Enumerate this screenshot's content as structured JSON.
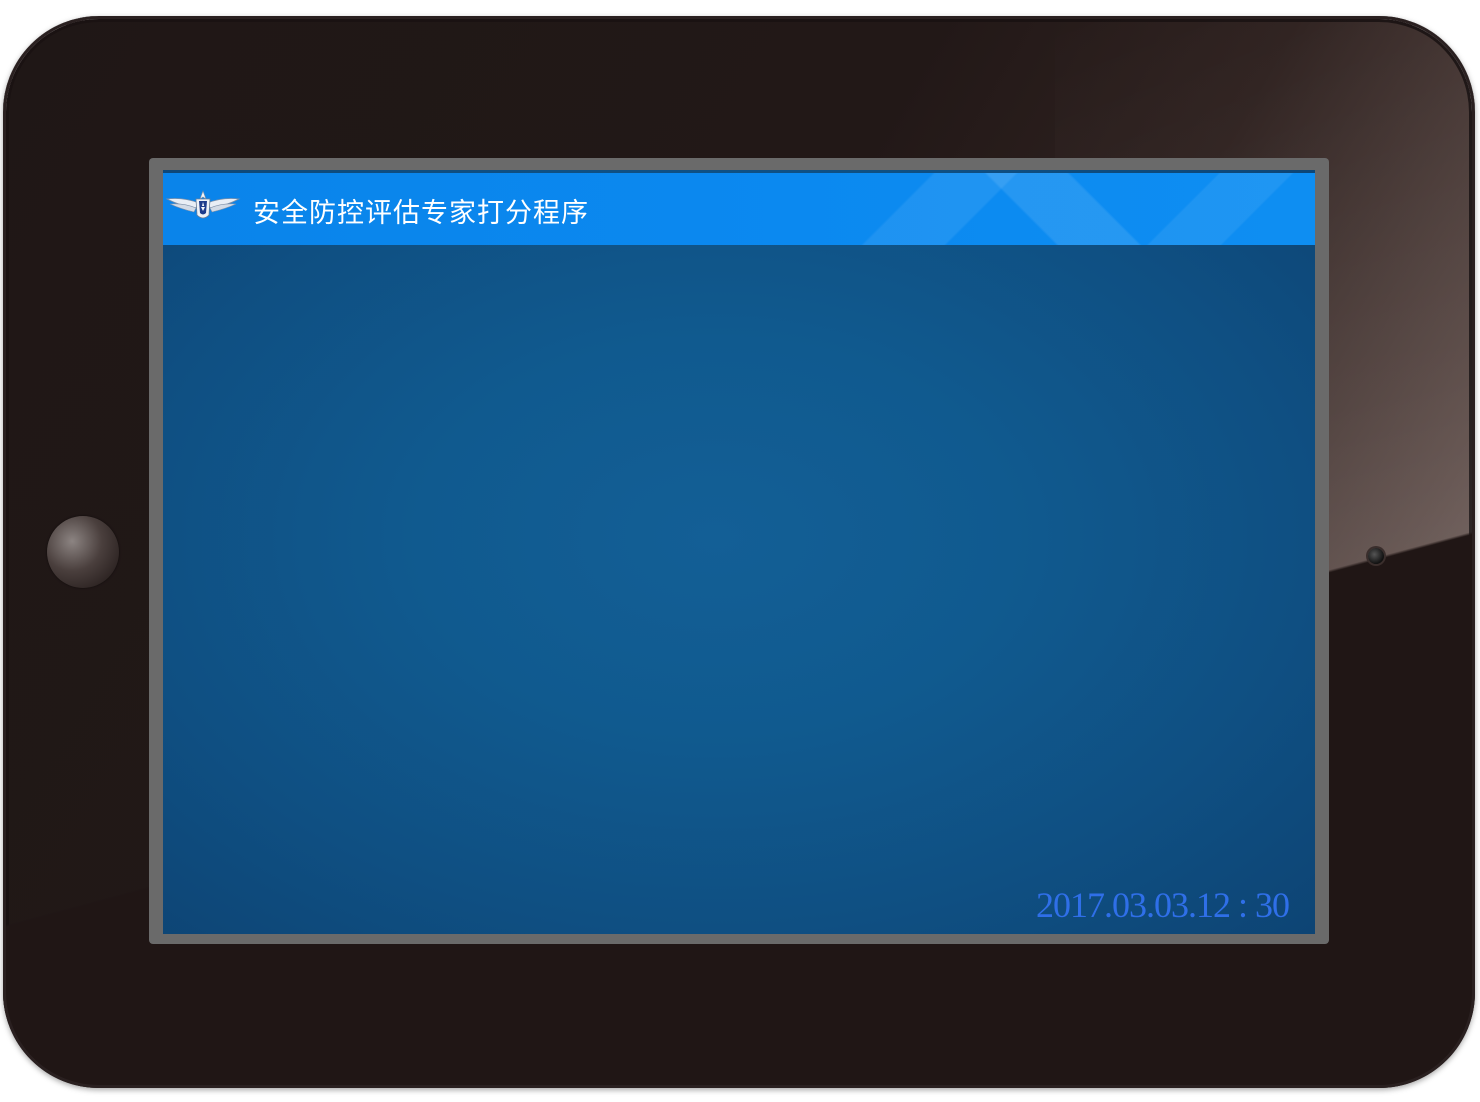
{
  "app": {
    "title": "安全防控评估专家打分程序",
    "logo_icon": "air-force-wings-emblem-icon"
  },
  "status": {
    "datetime": "2017.03.03.12 : 30"
  },
  "device": {
    "home_button_icon": "home-button-icon",
    "camera_icon": "front-camera-icon"
  },
  "colors": {
    "title_bar": "#0b89f0",
    "screen_background": "#105a8f",
    "timestamp_text": "#2f6fe8",
    "bezel": "#221817"
  }
}
